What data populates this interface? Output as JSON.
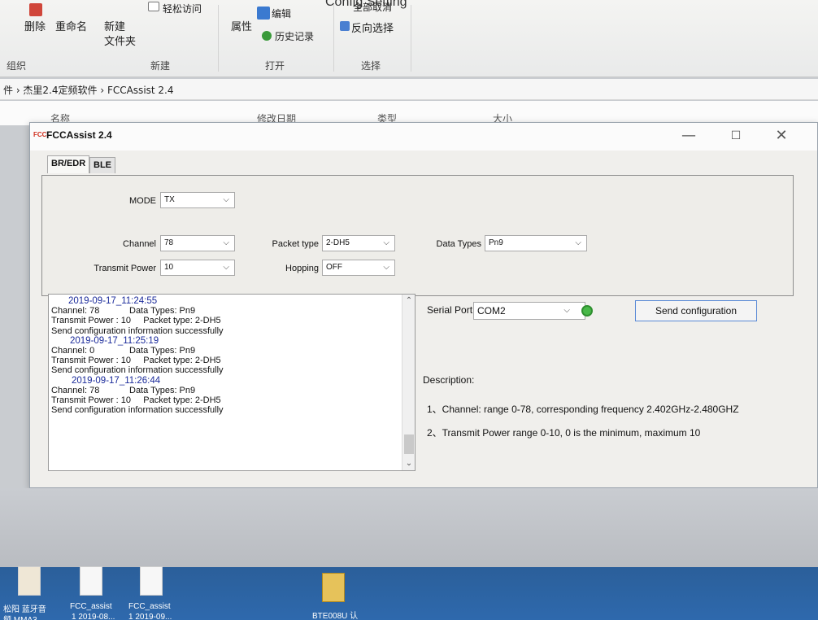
{
  "top_caption": "Config Setting",
  "ribbon": {
    "delete": "删除",
    "rename": "重命名",
    "new_folder_1": "新建",
    "new_folder_2": "文件夹",
    "easy_access": "轻松访问",
    "properties": "属性",
    "edit": "编辑",
    "history": "历史记录",
    "select_none": "全部取消",
    "invert_select": "反向选择",
    "group_organize": "组织",
    "group_new": "新建",
    "group_open": "打开",
    "group_select": "选择"
  },
  "address": "件 › 杰里2.4定频软件 › FCCAssist 2.4",
  "columns": {
    "name": "名称",
    "modified": "修改日期",
    "type": "类型",
    "size": "大小"
  },
  "window": {
    "title": "FCCAssist 2.4",
    "minimize": "—",
    "maximize": "☐",
    "close": "✕"
  },
  "tabs": [
    "BR/EDR",
    "BLE"
  ],
  "config": {
    "mode_label": "MODE",
    "mode_value": "TX",
    "channel_label": "Channel",
    "channel_value": "78",
    "packet_type_label": "Packet type",
    "packet_type_value": "2-DH5",
    "data_types_label": "Data Types",
    "data_types_value": "Pn9",
    "transmit_power_label": "Transmit Power",
    "transmit_power_value": "10",
    "hopping_label": "Hopping",
    "hopping_value": "OFF"
  },
  "log": [
    {
      "kind": "ts",
      "text": "2019-09-17_11:24:55"
    },
    {
      "kind": "line",
      "text": "Channel: 78            Data Types: Pn9"
    },
    {
      "kind": "line",
      "text": "Transmit Power : 10     Packet type: 2-DH5"
    },
    {
      "kind": "line",
      "text": "Send configuration information successfully"
    },
    {
      "kind": "ts",
      "text": "2019-09-17_11:25:19"
    },
    {
      "kind": "line",
      "text": "Channel: 0              Data Types: Pn9"
    },
    {
      "kind": "line",
      "text": "Transmit Power : 10     Packet type: 2-DH5"
    },
    {
      "kind": "line",
      "text": "Send configuration information successfully"
    },
    {
      "kind": "ts",
      "text": "2019-09-17_11:26:44"
    },
    {
      "kind": "line",
      "text": "Channel: 78            Data Types: Pn9"
    },
    {
      "kind": "line",
      "text": "Transmit Power : 10     Packet type: 2-DH5"
    },
    {
      "kind": "line",
      "text": "Send configuration information successfully"
    }
  ],
  "serial": {
    "label": "Serial Port",
    "value": "COM2"
  },
  "send_button": "Send configuration",
  "description": {
    "title": "Description:",
    "line1": "1、Channel: range 0-78, corresponding frequency 2.402GHz-2.480GHZ",
    "line2": "2、Transmit Power  range 0-10, 0 is the minimum, maximum 10"
  },
  "desktop": {
    "icon_labels": [
      "松阳 蓝牙音",
      "FCC_assist",
      "FCC_assist",
      "BTE008U 认"
    ],
    "icon_sublabels": [
      "频 MMA3...",
      "1 2019-08...",
      "1 2019-09..."
    ]
  }
}
